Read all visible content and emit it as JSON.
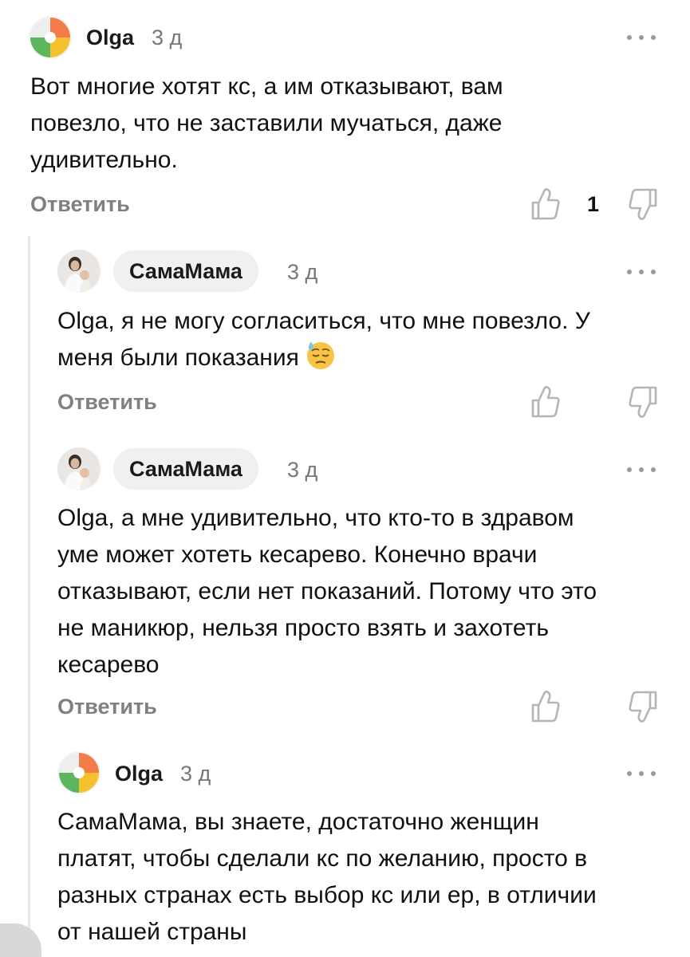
{
  "comments": [
    {
      "author": "Olga",
      "date": "3 д",
      "text_lines": [
        "Вот многие хотят кс, а им отказывают, вам",
        "повезло, что не заставили мучаться, даже",
        "удивительно."
      ],
      "reply_label": "Ответить",
      "like_count": "1"
    },
    {
      "author": "СамаМама",
      "date": "3 д",
      "text_lines": [
        "Olga, я не могу согласиться, что мне повезло. У",
        "меня были показания"
      ],
      "emoji_icon": "downcast-face-with-sweat-emoji",
      "reply_label": "Ответить"
    },
    {
      "author": "СамаМама",
      "date": "3 д",
      "text_lines": [
        "Olga, а мне удивительно, что кто-то в здравом",
        "уме может хотеть кесарево. Конечно врачи",
        "отказывают, если нет показаний. Потому что это",
        "не маникюр, нельзя просто взять и захотеть",
        "кесарево"
      ],
      "reply_label": "Ответить"
    },
    {
      "author": "Olga",
      "date": "3 д",
      "text_lines": [
        "СамаМама, вы знаете, достаточно женщин",
        "платят, чтобы сделали кс по желанию, просто в",
        "разных странах есть выбор кс или ер, в отличии",
        "от нашей страны"
      ]
    }
  ],
  "icons": {
    "like": "thumbs-up-icon",
    "dislike": "thumbs-down-icon",
    "more": "more-dots-icon",
    "olga_avatar": "colorful-pinwheel-avatar",
    "samamama_avatar": "mother-with-baby-photo-avatar"
  },
  "colors": {
    "pinwheel_orange": "#f47c4a",
    "pinwheel_yellow": "#f5c12e",
    "pinwheel_green": "#5cb55f",
    "reply_gray": "#808080",
    "pill_bg": "#f0f0f2"
  }
}
